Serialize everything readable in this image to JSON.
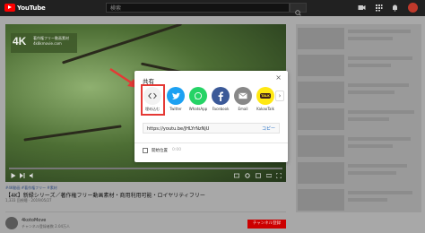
{
  "topbar": {
    "logo_text": "YouTube",
    "search_placeholder": "検索"
  },
  "video": {
    "badge_4k": "4K",
    "badge_text": "著作権フリー動画素材 4k8kmovie.com",
    "tags": "#4K動画 #著作権フリー #素材",
    "title": "【4K】新緑シリーズ／著作権フリー動画素材・商用利用可能・ロイヤリティフリー",
    "stats": "1,333 回視聴 · 2019/05/27"
  },
  "channel": {
    "name": "4kotoMove",
    "subscribers": "チャンネル登録者数 2.04万人",
    "subscribe_label": "チャンネル登録"
  },
  "share_dialog": {
    "title": "共有",
    "close": "×",
    "next": "›",
    "items": [
      {
        "label": "埋め込む",
        "icon": "embed-icon",
        "color": "#f2f2f2"
      },
      {
        "label": "Twitter",
        "icon": "twitter-icon",
        "color": "#1da1f2"
      },
      {
        "label": "WhatsApp",
        "icon": "whatsapp-icon",
        "color": "#25d366"
      },
      {
        "label": "Facebook",
        "icon": "facebook-icon",
        "color": "#3b5998"
      },
      {
        "label": "Email",
        "icon": "email-icon",
        "color": "#888888"
      },
      {
        "label": "KakaoTalk",
        "icon": "kakaotalk-icon",
        "color": "#ffe812"
      }
    ],
    "kakao_badge": "TALK",
    "url": "https://youtu.be/JHLYrNzNjU",
    "copy_label": "コピー",
    "start_label": "開始位置",
    "start_time": "0:00"
  },
  "colors": {
    "highlight": "#e53935",
    "arrow": "#e53935",
    "accent": "#cc0000"
  }
}
